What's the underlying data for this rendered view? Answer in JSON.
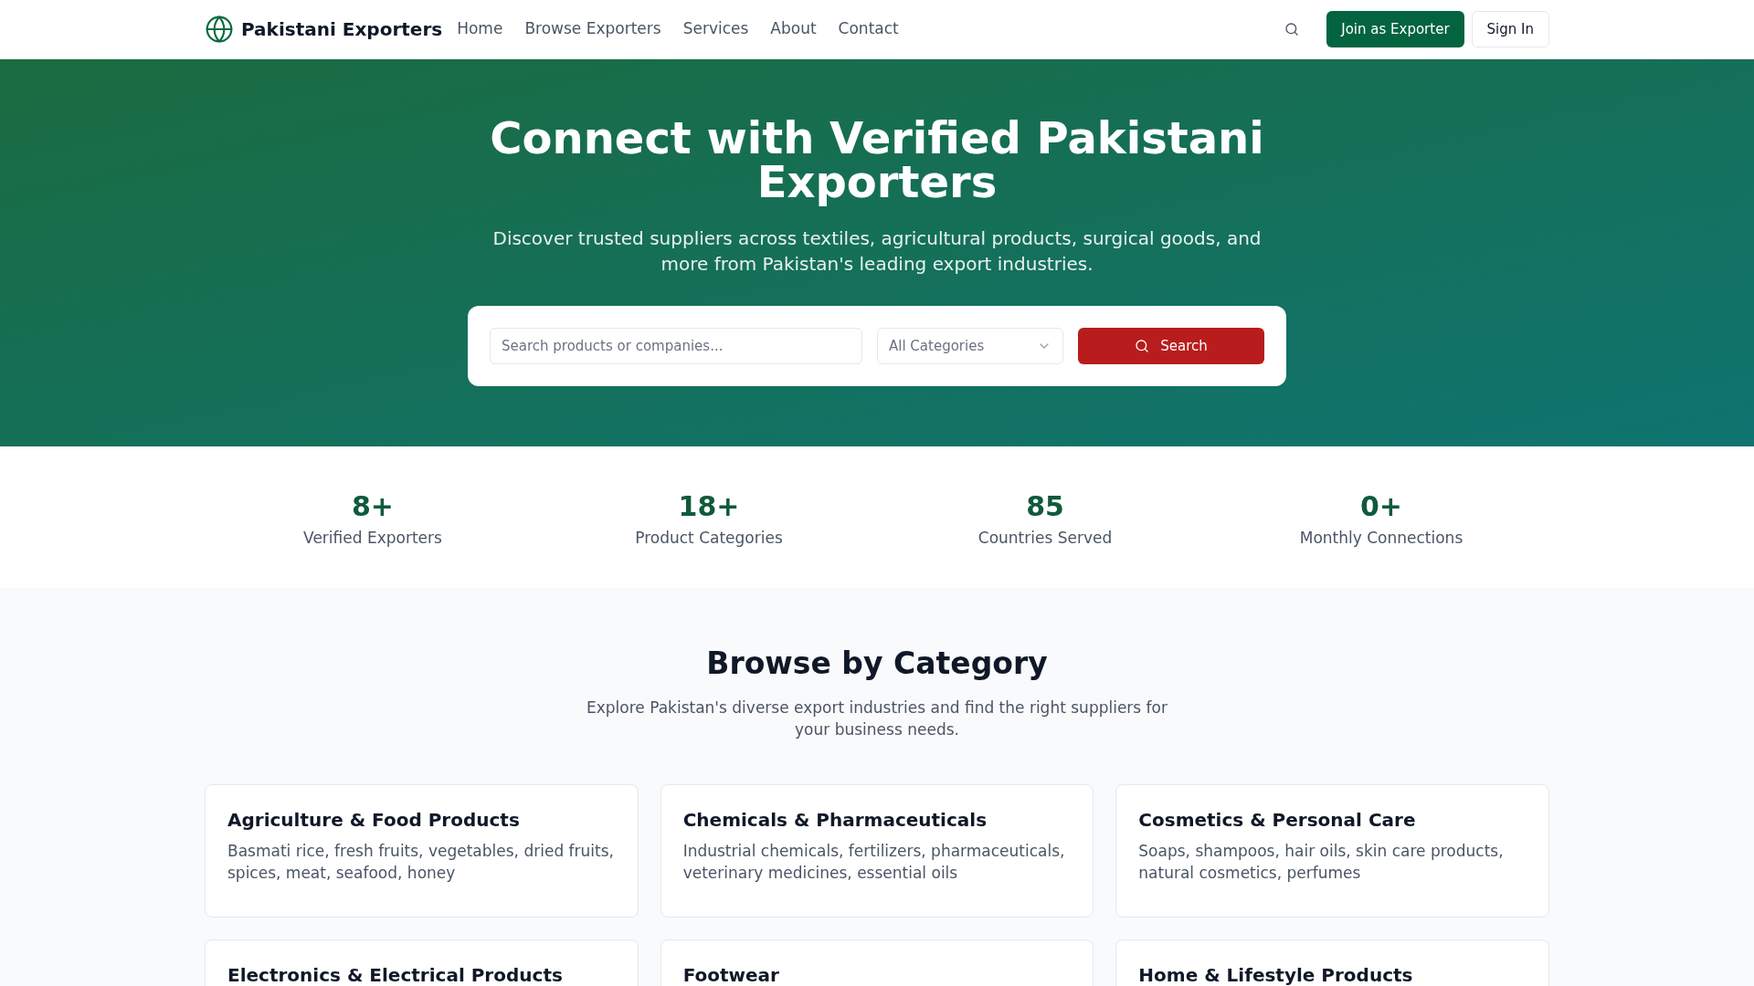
{
  "header": {
    "logo": "Pakistani Exporters",
    "nav": [
      {
        "label": "Home"
      },
      {
        "label": "Browse Exporters"
      },
      {
        "label": "Services"
      },
      {
        "label": "About"
      },
      {
        "label": "Contact"
      }
    ],
    "join_button": "Join as Exporter",
    "sign_in_button": "Sign In"
  },
  "hero": {
    "title": "Connect with Verified Pakistani Exporters",
    "subtitle": "Discover trusted suppliers across textiles, agricultural products, surgical goods, and more from Pakistan's leading export industries.",
    "search": {
      "placeholder": "Search products or companies...",
      "category": "All Categories",
      "button": "Search"
    }
  },
  "stats": [
    {
      "value": "8+",
      "label": "Verified Exporters"
    },
    {
      "value": "18+",
      "label": "Product Categories"
    },
    {
      "value": "85",
      "label": "Countries Served"
    },
    {
      "value": "0+",
      "label": "Monthly Connections"
    }
  ],
  "categories": {
    "title": "Browse by Category",
    "subtitle": "Explore Pakistan's diverse export industries and find the right suppliers for your business needs.",
    "cards": [
      {
        "title": "Agriculture & Food Products",
        "description": "Basmati rice, fresh fruits, vegetables, dried fruits, spices, meat, seafood, honey"
      },
      {
        "title": "Chemicals & Pharmaceuticals",
        "description": "Industrial chemicals, fertilizers, pharmaceuticals, veterinary medicines, essential oils"
      },
      {
        "title": "Cosmetics & Personal Care",
        "description": "Soaps, shampoos, hair oils, skin care products, natural cosmetics, perfumes"
      },
      {
        "title": "Electronics & Electrical Products"
      },
      {
        "title": "Footwear"
      },
      {
        "title": "Home & Lifestyle Products"
      }
    ]
  }
}
